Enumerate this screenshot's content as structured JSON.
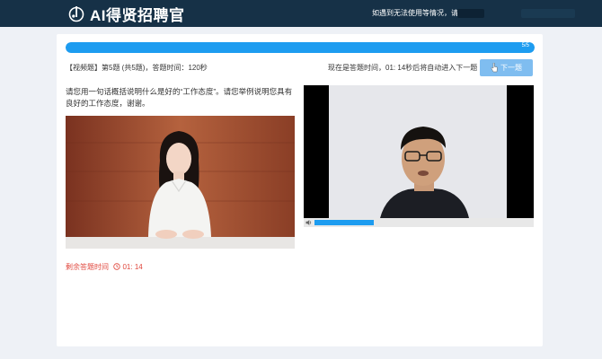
{
  "header": {
    "title": "AI得贤招聘官",
    "notice": "如遇到无法使用等情况，请联"
  },
  "progress": {
    "value": 1.0,
    "label": "5/5"
  },
  "question_meta": "【视频题】第5题 (共5题)，答题时间：120秒",
  "timer_note": "现在是答题时间，01: 14秒后将自动进入下一题",
  "next_button": "下一题",
  "question_text": "请您用一句话概括说明什么是好的“工作态度”。请您举例说明您具有良好的工作态度，谢谢。",
  "remaining": {
    "label": "剩余答题时间",
    "time": "01: 14"
  },
  "video": {
    "playback_progress": 0.27
  },
  "colors": {
    "header_bg": "#163147",
    "accent": "#1d9cf0",
    "button": "#7fbdf0",
    "warning": "#e0463c"
  },
  "icons": [
    "logo-icon",
    "cursor-icon",
    "clock-icon",
    "volume-icon"
  ]
}
